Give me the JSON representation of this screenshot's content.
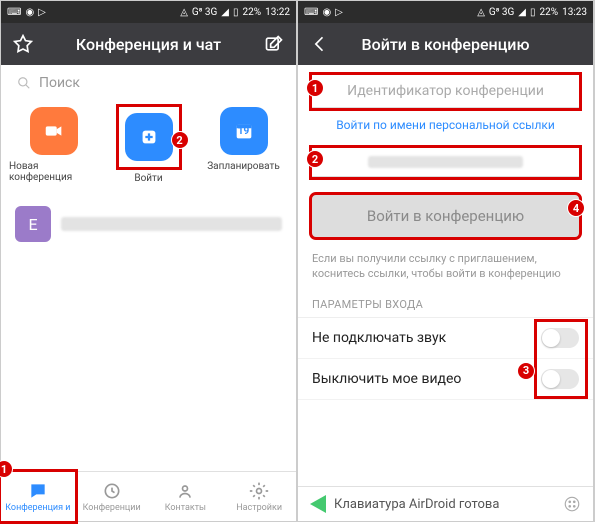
{
  "left": {
    "status": {
      "net": "G⁸ 3G",
      "bat": "22%",
      "time": "13:22"
    },
    "header": {
      "title": "Конференция и чат"
    },
    "search": {
      "placeholder": "Поиск"
    },
    "actions": {
      "new": {
        "label": "Новая конференция"
      },
      "join": {
        "label": "Войти",
        "badge": "2"
      },
      "plan": {
        "label": "Запланировать",
        "day": "19"
      }
    },
    "chat": {
      "avatar": "E"
    },
    "nav": {
      "conf": {
        "label": "Конференция и",
        "badge": "1"
      },
      "conflist": {
        "label": "Конференции"
      },
      "contacts": {
        "label": "Контакты"
      },
      "settings": {
        "label": "Настройки"
      }
    }
  },
  "right": {
    "status": {
      "net": "G⁸ 3G",
      "bat": "22%",
      "time": "13:23"
    },
    "header": {
      "title": "Войти в конференцию"
    },
    "field_id": {
      "placeholder": "Идентификатор конференции",
      "badge": "1"
    },
    "link": "Войти по имени персональной ссылки",
    "field_name": {
      "badge": "2"
    },
    "join_btn": {
      "label": "Войти в конференцию",
      "badge": "4"
    },
    "hint": "Если вы получили ссылку с приглашением, коснитесь ссылки, чтобы войти в конференцию",
    "section": "ПАРАМЕТРЫ ВХОДА",
    "opt_audio": "Не подключать звук",
    "opt_video": "Выключить мое видео",
    "toggle_badge": "3",
    "airdroid": "Клавиатура AirDroid готова"
  }
}
